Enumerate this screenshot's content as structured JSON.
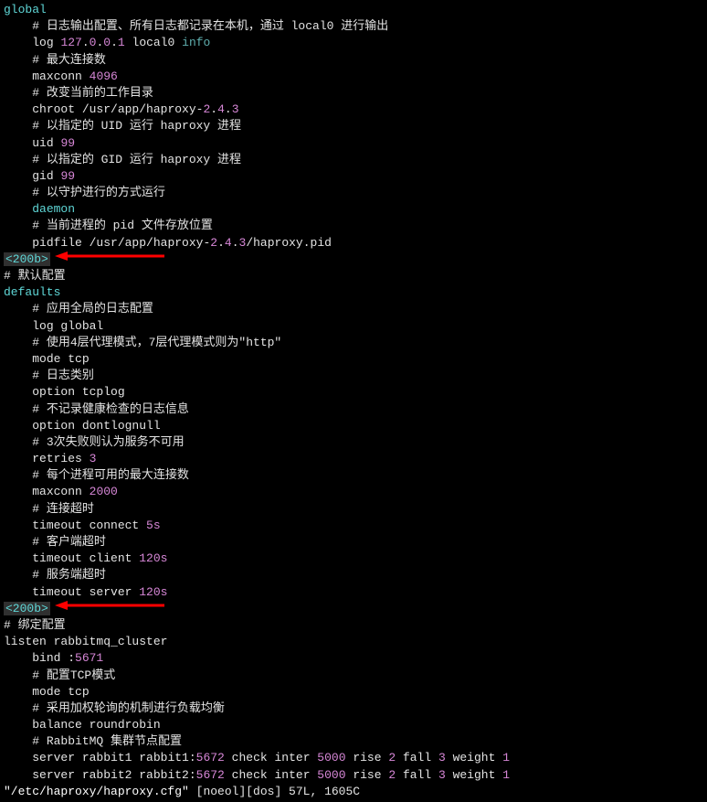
{
  "lines": [
    {
      "cls": "cyan",
      "text": "global"
    },
    {
      "cls": "white",
      "indent": "    ",
      "text": "# 日志输出配置、所有日志都记录在本机，通过 local0 进行输出"
    },
    {
      "cls": "white",
      "indent": "    ",
      "segments": [
        {
          "cls": "white",
          "t": "log "
        },
        {
          "cls": "magenta",
          "t": "127"
        },
        {
          "cls": "white",
          "t": "."
        },
        {
          "cls": "magenta",
          "t": "0"
        },
        {
          "cls": "white",
          "t": "."
        },
        {
          "cls": "magenta",
          "t": "0"
        },
        {
          "cls": "white",
          "t": "."
        },
        {
          "cls": "magenta",
          "t": "1"
        },
        {
          "cls": "white",
          "t": " local0 "
        },
        {
          "cls": "teal",
          "t": "info"
        }
      ]
    },
    {
      "cls": "white",
      "indent": "    ",
      "text": "# 最大连接数"
    },
    {
      "cls": "white",
      "indent": "    ",
      "segments": [
        {
          "cls": "white",
          "t": "maxconn "
        },
        {
          "cls": "magenta",
          "t": "4096"
        }
      ]
    },
    {
      "cls": "white",
      "indent": "    ",
      "text": "# 改变当前的工作目录"
    },
    {
      "cls": "white",
      "indent": "    ",
      "segments": [
        {
          "cls": "white",
          "t": "chroot /usr/app/haproxy-"
        },
        {
          "cls": "magenta",
          "t": "2"
        },
        {
          "cls": "white",
          "t": "."
        },
        {
          "cls": "magenta",
          "t": "4"
        },
        {
          "cls": "white",
          "t": "."
        },
        {
          "cls": "magenta",
          "t": "3"
        }
      ]
    },
    {
      "cls": "white",
      "indent": "    ",
      "text": "# 以指定的 UID 运行 haproxy 进程"
    },
    {
      "cls": "white",
      "indent": "    ",
      "segments": [
        {
          "cls": "white",
          "t": "uid "
        },
        {
          "cls": "magenta",
          "t": "99"
        }
      ]
    },
    {
      "cls": "white",
      "indent": "    ",
      "text": "# 以指定的 GID 运行 haproxy 进程"
    },
    {
      "cls": "white",
      "indent": "    ",
      "segments": [
        {
          "cls": "white",
          "t": "gid "
        },
        {
          "cls": "magenta",
          "t": "99"
        }
      ]
    },
    {
      "cls": "white",
      "indent": "    ",
      "text": "# 以守护进行的方式运行"
    },
    {
      "cls": "cyan",
      "indent": "    ",
      "text": "daemon"
    },
    {
      "cls": "white",
      "indent": "    ",
      "text": "# 当前进程的 pid 文件存放位置"
    },
    {
      "cls": "white",
      "indent": "    ",
      "segments": [
        {
          "cls": "white",
          "t": "pidfile /usr/app/haproxy-"
        },
        {
          "cls": "magenta",
          "t": "2"
        },
        {
          "cls": "white",
          "t": "."
        },
        {
          "cls": "magenta",
          "t": "4"
        },
        {
          "cls": "white",
          "t": "."
        },
        {
          "cls": "magenta",
          "t": "3"
        },
        {
          "cls": "white",
          "t": "/haproxy.pid"
        }
      ]
    },
    {
      "special": true,
      "text": "<200b>",
      "arrow": true,
      "arrowTop": 290
    },
    {
      "cls": "white",
      "text": "# 默认配置"
    },
    {
      "cls": "cyan",
      "text": "defaults"
    },
    {
      "cls": "white",
      "indent": "    ",
      "text": "# 应用全局的日志配置"
    },
    {
      "cls": "white",
      "indent": "    ",
      "text": "log global"
    },
    {
      "cls": "white",
      "indent": "    ",
      "text": "# 使用4层代理模式，7层代理模式则为\"http\""
    },
    {
      "cls": "white",
      "indent": "    ",
      "text": "mode tcp"
    },
    {
      "cls": "white",
      "indent": "    ",
      "text": "# 日志类别"
    },
    {
      "cls": "white",
      "indent": "    ",
      "text": "option tcplog"
    },
    {
      "cls": "white",
      "indent": "    ",
      "text": "# 不记录健康检查的日志信息"
    },
    {
      "cls": "white",
      "indent": "    ",
      "text": "option dontlognull"
    },
    {
      "cls": "white",
      "indent": "    ",
      "text": "# 3次失败则认为服务不可用"
    },
    {
      "cls": "white",
      "indent": "    ",
      "segments": [
        {
          "cls": "white",
          "t": "retries "
        },
        {
          "cls": "magenta",
          "t": "3"
        }
      ]
    },
    {
      "cls": "white",
      "indent": "    ",
      "text": "# 每个进程可用的最大连接数"
    },
    {
      "cls": "white",
      "indent": "    ",
      "segments": [
        {
          "cls": "white",
          "t": "maxconn "
        },
        {
          "cls": "magenta",
          "t": "2000"
        }
      ]
    },
    {
      "cls": "white",
      "indent": "    ",
      "text": "# 连接超时"
    },
    {
      "cls": "white",
      "indent": "    ",
      "segments": [
        {
          "cls": "white",
          "t": "timeout connect "
        },
        {
          "cls": "magenta",
          "t": "5s"
        }
      ]
    },
    {
      "cls": "white",
      "indent": "    ",
      "text": "# 客户端超时"
    },
    {
      "cls": "white",
      "indent": "    ",
      "segments": [
        {
          "cls": "white",
          "t": "timeout client "
        },
        {
          "cls": "magenta",
          "t": "120s"
        }
      ]
    },
    {
      "cls": "white",
      "indent": "    ",
      "text": "# 服务端超时"
    },
    {
      "cls": "white",
      "indent": "    ",
      "segments": [
        {
          "cls": "white",
          "t": "timeout server "
        },
        {
          "cls": "magenta",
          "t": "120s"
        }
      ]
    },
    {
      "special": true,
      "text": "<200b>",
      "arrow": true,
      "arrowTop": 618
    },
    {
      "cls": "white",
      "text": "# 绑定配置"
    },
    {
      "cls": "white",
      "text": "listen rabbitmq_cluster"
    },
    {
      "cls": "white",
      "indent": "    ",
      "segments": [
        {
          "cls": "white",
          "t": "bind :"
        },
        {
          "cls": "magenta",
          "t": "5671"
        }
      ]
    },
    {
      "cls": "white",
      "indent": "    ",
      "text": "# 配置TCP模式"
    },
    {
      "cls": "white",
      "indent": "    ",
      "text": "mode tcp"
    },
    {
      "cls": "white",
      "indent": "    ",
      "text": "# 采用加权轮询的机制进行负载均衡"
    },
    {
      "cls": "white",
      "indent": "    ",
      "text": "balance roundrobin"
    },
    {
      "cls": "white",
      "indent": "    ",
      "text": "# RabbitMQ 集群节点配置"
    },
    {
      "cls": "white",
      "indent": "    ",
      "segments": [
        {
          "cls": "white",
          "t": "server rabbit1 rabbit1:"
        },
        {
          "cls": "magenta",
          "t": "5672"
        },
        {
          "cls": "white",
          "t": " check inter "
        },
        {
          "cls": "magenta",
          "t": "5000"
        },
        {
          "cls": "white",
          "t": " rise "
        },
        {
          "cls": "magenta",
          "t": "2"
        },
        {
          "cls": "white",
          "t": " fall "
        },
        {
          "cls": "magenta",
          "t": "3"
        },
        {
          "cls": "white",
          "t": " weight "
        },
        {
          "cls": "magenta",
          "t": "1"
        }
      ]
    },
    {
      "cls": "white",
      "indent": "    ",
      "segments": [
        {
          "cls": "white",
          "t": "server rabbit2 rabbit2:"
        },
        {
          "cls": "magenta",
          "t": "5672"
        },
        {
          "cls": "white",
          "t": " check inter "
        },
        {
          "cls": "magenta",
          "t": "5000"
        },
        {
          "cls": "white",
          "t": " rise "
        },
        {
          "cls": "magenta",
          "t": "2"
        },
        {
          "cls": "white",
          "t": " fall "
        },
        {
          "cls": "magenta",
          "t": "3"
        },
        {
          "cls": "white",
          "t": " weight "
        },
        {
          "cls": "magenta",
          "t": "1"
        }
      ]
    }
  ],
  "status": {
    "filename": "\"/etc/haproxy/haproxy.cfg\"",
    "flags": " [noeol][dos] 57L, 1605C"
  }
}
